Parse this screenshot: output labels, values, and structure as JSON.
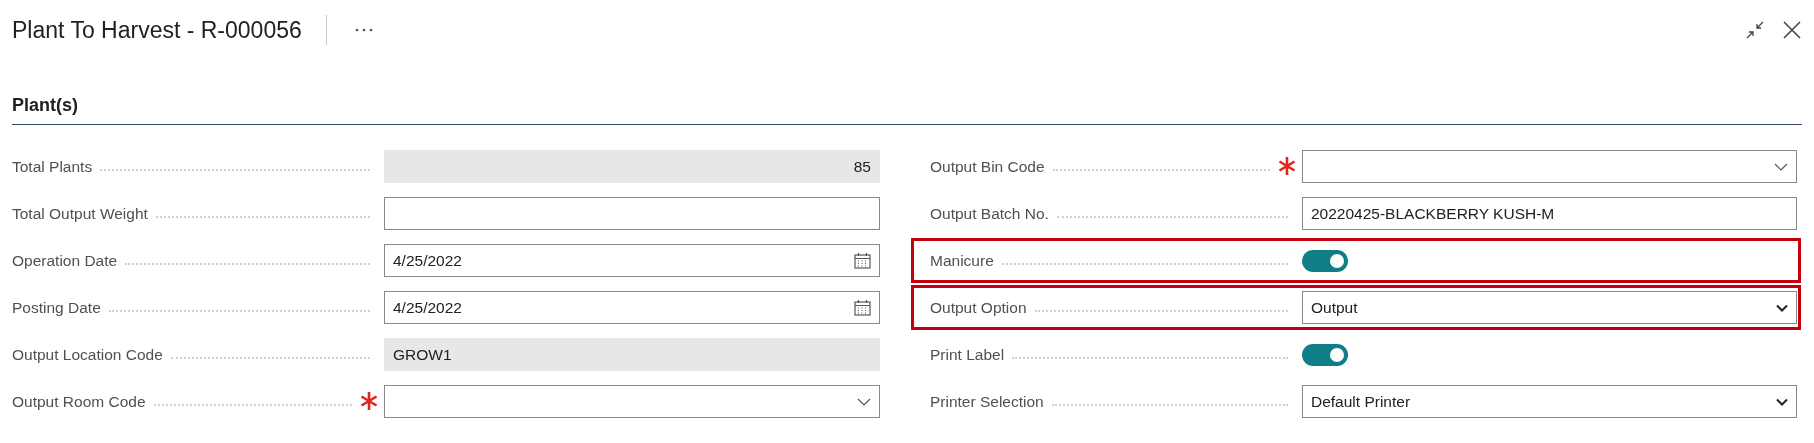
{
  "title": "Plant To Harvest - R-000056",
  "section": "Plant(s)",
  "columns": [
    [
      {
        "label": "Total Plants",
        "kind": "number",
        "value": "85",
        "readonly": true,
        "required": false,
        "highlighted": false
      },
      {
        "label": "Total Output Weight",
        "kind": "text",
        "readonly": false,
        "required": false,
        "highlighted": false
      },
      {
        "label": "Operation Date",
        "kind": "date",
        "value": "4/25/2022",
        "readonly": false,
        "required": false,
        "highlighted": false
      },
      {
        "label": "Posting Date",
        "kind": "date",
        "value": "4/25/2022",
        "readonly": false,
        "required": false,
        "highlighted": false
      },
      {
        "label": "Output Location Code",
        "kind": "text",
        "value": "GROW1",
        "readonly": true,
        "required": false,
        "highlighted": false
      },
      {
        "label": "Output Room Code",
        "kind": "lookup",
        "readonly": false,
        "required": true,
        "highlighted": false
      }
    ],
    [
      {
        "label": "Output Bin Code",
        "kind": "lookup",
        "readonly": false,
        "required": true,
        "highlighted": false
      },
      {
        "label": "Output Batch No.",
        "kind": "text",
        "value": "20220425-BLACKBERRY KUSH-M",
        "readonly": false,
        "required": false,
        "highlighted": false
      },
      {
        "label": "Manicure",
        "kind": "toggle",
        "on": true,
        "required": false,
        "highlighted": true
      },
      {
        "label": "Output Option",
        "kind": "select",
        "value": "Output",
        "readonly": false,
        "required": false,
        "highlighted": true
      },
      {
        "label": "Print Label",
        "kind": "toggle",
        "on": true,
        "required": false,
        "highlighted": false
      },
      {
        "label": "Printer Selection",
        "kind": "select",
        "value": "Default Printer",
        "readonly": false,
        "required": false,
        "highlighted": false
      }
    ]
  ]
}
